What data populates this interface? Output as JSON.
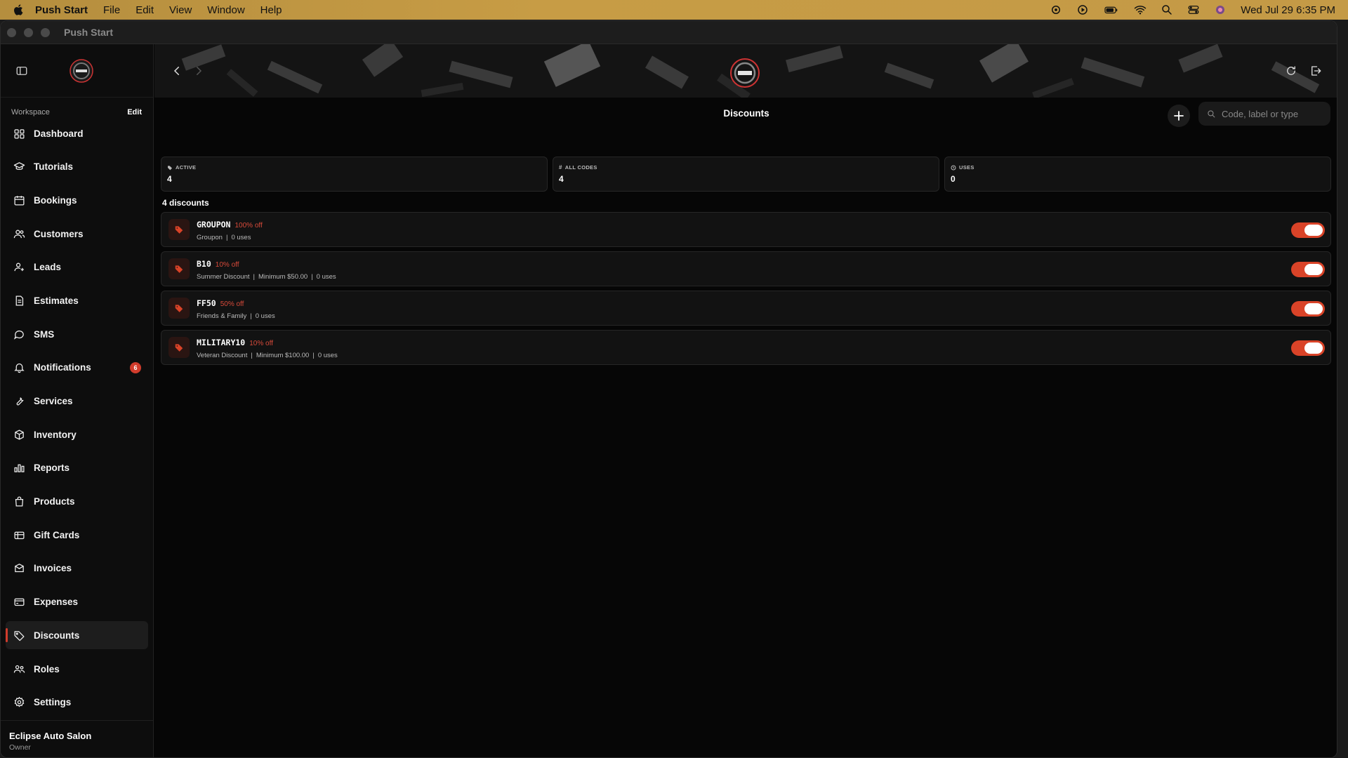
{
  "menubar": {
    "app_name": "Push Start",
    "menus": [
      "File",
      "Edit",
      "View",
      "Window",
      "Help"
    ],
    "clock": "Wed Jul 29  6:35 PM"
  },
  "window": {
    "title": "Push Start"
  },
  "sidebar": {
    "workspace_label": "Workspace",
    "edit_label": "Edit",
    "items": [
      {
        "label": "Dashboard",
        "icon": "grid-icon"
      },
      {
        "label": "Tutorials",
        "icon": "graduation-cap-icon"
      },
      {
        "label": "Bookings",
        "icon": "calendar-icon"
      },
      {
        "label": "Customers",
        "icon": "users-icon"
      },
      {
        "label": "Leads",
        "icon": "user-plus-icon"
      },
      {
        "label": "Estimates",
        "icon": "document-icon"
      },
      {
        "label": "SMS",
        "icon": "chat-bubble-icon"
      },
      {
        "label": "Notifications",
        "icon": "bell-icon",
        "badge": "6"
      },
      {
        "label": "Services",
        "icon": "wrench-icon"
      },
      {
        "label": "Inventory",
        "icon": "box-icon"
      },
      {
        "label": "Reports",
        "icon": "bar-chart-icon"
      },
      {
        "label": "Products",
        "icon": "shopping-bag-icon"
      },
      {
        "label": "Gift Cards",
        "icon": "gift-card-icon"
      },
      {
        "label": "Invoices",
        "icon": "invoice-icon"
      },
      {
        "label": "Expenses",
        "icon": "credit-card-icon"
      },
      {
        "label": "Discounts",
        "icon": "tag-icon",
        "active": true
      },
      {
        "label": "Roles",
        "icon": "users-roles-icon"
      },
      {
        "label": "Settings",
        "icon": "gear-icon"
      }
    ],
    "footer": {
      "org": "Eclipse Auto Salon",
      "role": "Owner"
    }
  },
  "main": {
    "title": "Discounts",
    "search_placeholder": "Code, label or type",
    "stats": [
      {
        "label": "ACTIVE",
        "value": "4",
        "icon": "tag-icon"
      },
      {
        "label": "ALL CODES",
        "value": "4",
        "icon": "hash-icon"
      },
      {
        "label": "USES",
        "value": "0",
        "icon": "clock-icon"
      }
    ],
    "count_label": "4 discounts",
    "discounts": [
      {
        "code": "GROUPON",
        "off": "100% off",
        "details": [
          "Groupon",
          "0 uses"
        ],
        "enabled": true
      },
      {
        "code": "B10",
        "off": "10% off",
        "details": [
          "Summer Discount",
          "Minimum $50.00",
          "0 uses"
        ],
        "enabled": true
      },
      {
        "code": "FF50",
        "off": "50% off",
        "details": [
          "Friends & Family",
          "0 uses"
        ],
        "enabled": true
      },
      {
        "code": "MILITARY10",
        "off": "10% off",
        "details": [
          "Veteran Discount",
          "Minimum $100.00",
          "0 uses"
        ],
        "enabled": true
      }
    ]
  },
  "colors": {
    "accent": "#d94328",
    "background": "#060606",
    "menubar": "#c49a46"
  }
}
